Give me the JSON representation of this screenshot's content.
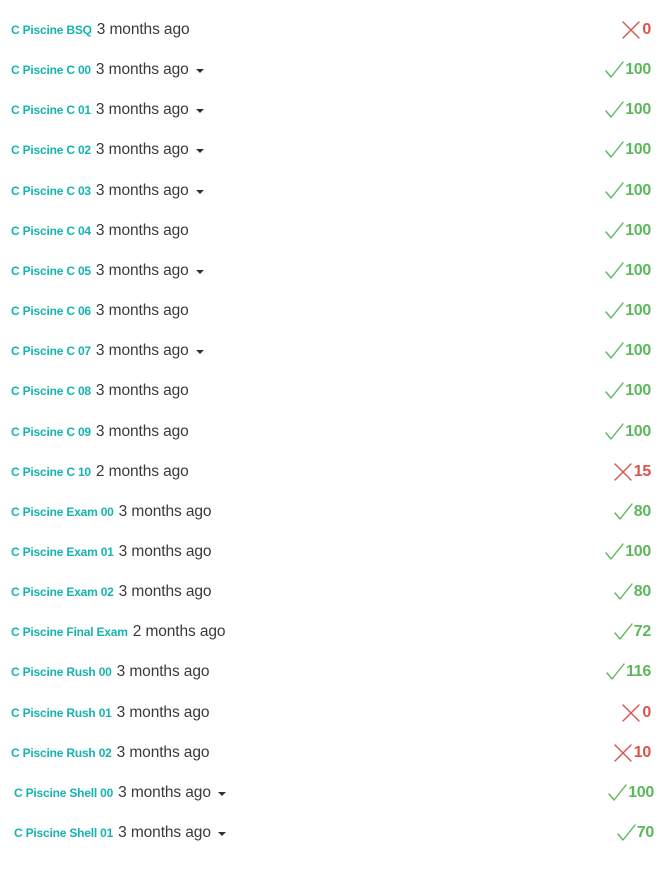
{
  "colors": {
    "link": "#17b3b1",
    "pass": "#5cb85c",
    "fail": "#d9534f",
    "text": "#3a3a3a"
  },
  "projects": [
    {
      "name": "C Piscine BSQ",
      "time": "3 months ago",
      "dropdown": false,
      "status": "fail",
      "score": "0"
    },
    {
      "name": "C Piscine C 00",
      "time": "3 months ago",
      "dropdown": true,
      "status": "pass",
      "score": "100"
    },
    {
      "name": "C Piscine C 01",
      "time": "3 months ago",
      "dropdown": true,
      "status": "pass",
      "score": "100"
    },
    {
      "name": "C Piscine C 02",
      "time": "3 months ago",
      "dropdown": true,
      "status": "pass",
      "score": "100"
    },
    {
      "name": "C Piscine C 03",
      "time": "3 months ago",
      "dropdown": true,
      "status": "pass",
      "score": "100"
    },
    {
      "name": "C Piscine C 04",
      "time": "3 months ago",
      "dropdown": false,
      "status": "pass",
      "score": "100"
    },
    {
      "name": "C Piscine C 05",
      "time": "3 months ago",
      "dropdown": true,
      "status": "pass",
      "score": "100"
    },
    {
      "name": "C Piscine C 06",
      "time": "3 months ago",
      "dropdown": false,
      "status": "pass",
      "score": "100"
    },
    {
      "name": "C Piscine C 07",
      "time": "3 months ago",
      "dropdown": true,
      "status": "pass",
      "score": "100"
    },
    {
      "name": "C Piscine C 08",
      "time": "3 months ago",
      "dropdown": false,
      "status": "pass",
      "score": "100"
    },
    {
      "name": "C Piscine C 09",
      "time": "3 months ago",
      "dropdown": false,
      "status": "pass",
      "score": "100"
    },
    {
      "name": "C Piscine C 10",
      "time": "2 months ago",
      "dropdown": false,
      "status": "fail",
      "score": "15"
    },
    {
      "name": "C Piscine Exam 00",
      "time": "3 months ago",
      "dropdown": false,
      "status": "pass",
      "score": "80"
    },
    {
      "name": "C Piscine Exam 01",
      "time": "3 months ago",
      "dropdown": false,
      "status": "pass",
      "score": "100"
    },
    {
      "name": "C Piscine Exam 02",
      "time": "3 months ago",
      "dropdown": false,
      "status": "pass",
      "score": "80"
    },
    {
      "name": "C Piscine Final Exam",
      "time": "2 months ago",
      "dropdown": false,
      "status": "pass",
      "score": "72"
    },
    {
      "name": "C Piscine Rush 00",
      "time": "3 months ago",
      "dropdown": false,
      "status": "pass",
      "score": "116"
    },
    {
      "name": "C Piscine Rush 01",
      "time": "3 months ago",
      "dropdown": false,
      "status": "fail",
      "score": "0"
    },
    {
      "name": "C Piscine Rush 02",
      "time": "3 months ago",
      "dropdown": false,
      "status": "fail",
      "score": "10"
    },
    {
      "name": "C Piscine Shell 00",
      "time": "3 months ago",
      "dropdown": true,
      "status": "pass",
      "score": "100"
    },
    {
      "name": "C Piscine Shell 01",
      "time": "3 months ago",
      "dropdown": true,
      "status": "pass",
      "score": "70"
    }
  ]
}
